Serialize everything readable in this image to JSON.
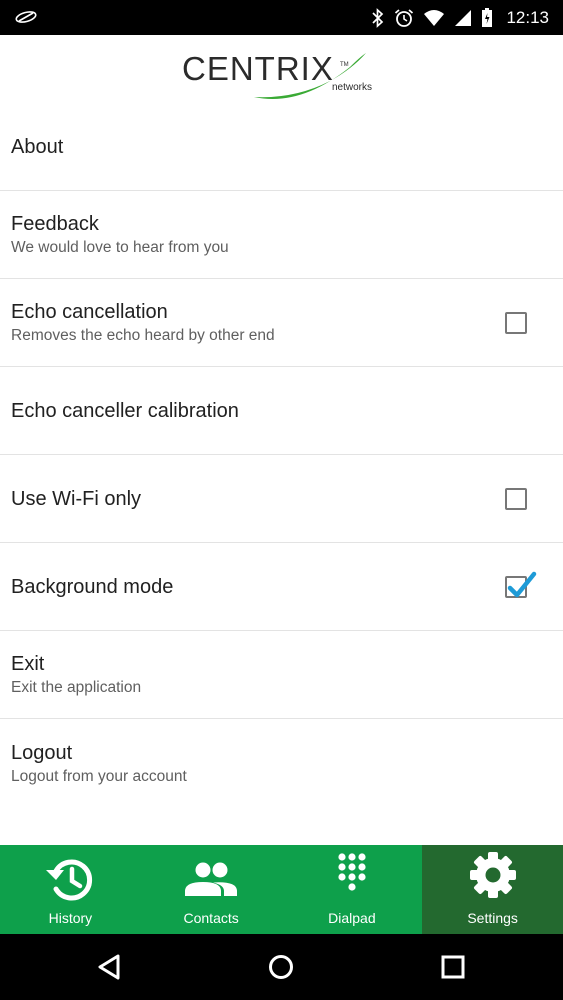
{
  "status_bar": {
    "time": "12:13",
    "icons": [
      "app-notification-icon",
      "bluetooth-icon",
      "alarm-icon",
      "wifi-icon",
      "signal-icon",
      "battery-icon"
    ]
  },
  "header": {
    "logo_text": "CENTRIX",
    "logo_tm": "TM",
    "logo_sub": "networks"
  },
  "settings": [
    {
      "title": "About",
      "subtitle": "",
      "checkbox": null
    },
    {
      "title": "Feedback",
      "subtitle": "We would love to hear from you",
      "checkbox": null
    },
    {
      "title": "Echo cancellation",
      "subtitle": "Removes the echo heard by other end",
      "checkbox": false
    },
    {
      "title": "Echo canceller calibration",
      "subtitle": "",
      "checkbox": null
    },
    {
      "title": "Use Wi-Fi only",
      "subtitle": "",
      "checkbox": false
    },
    {
      "title": "Background mode",
      "subtitle": "",
      "checkbox": true
    },
    {
      "title": "Exit",
      "subtitle": "Exit the application",
      "checkbox": null
    },
    {
      "title": "Logout",
      "subtitle": "Logout from your account",
      "checkbox": null
    }
  ],
  "tabs": [
    {
      "label": "History",
      "icon": "history-icon",
      "active": false
    },
    {
      "label": "Contacts",
      "icon": "contacts-icon",
      "active": false
    },
    {
      "label": "Dialpad",
      "icon": "dialpad-icon",
      "active": false
    },
    {
      "label": "Settings",
      "icon": "settings-gear-icon",
      "active": true
    }
  ],
  "nav_bar": [
    "back-icon",
    "home-icon",
    "recents-icon"
  ],
  "colors": {
    "tab_bar": "#0ea04b",
    "tab_active": "#23692f",
    "logo_green": "#3aaa35",
    "checkbox_check": "#1e9bd7"
  }
}
